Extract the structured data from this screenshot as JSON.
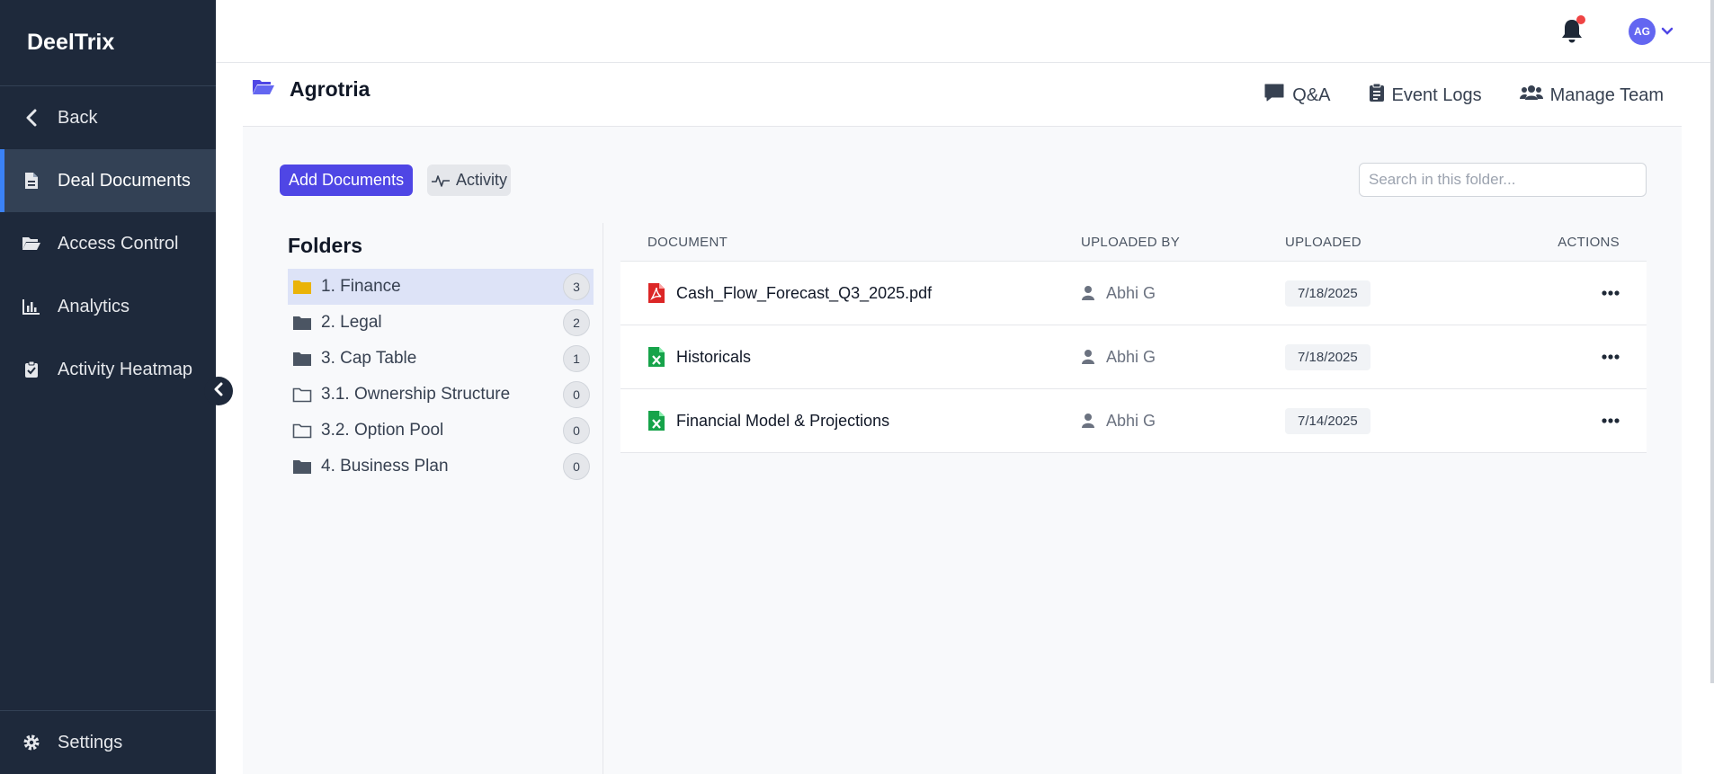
{
  "sidebar": {
    "brand": "DeelTrix",
    "items": [
      {
        "label": "Back",
        "icon": "chevron-left-icon"
      },
      {
        "label": "Deal Documents",
        "icon": "file-icon",
        "active": true
      },
      {
        "label": "Access Control",
        "icon": "folder-open-icon"
      },
      {
        "label": "Analytics",
        "icon": "chart-icon"
      },
      {
        "label": "Activity Heatmap",
        "icon": "clipboard-check-icon"
      }
    ],
    "settings_label": "Settings"
  },
  "topbar": {
    "avatar_initials": "AG"
  },
  "project": {
    "title": "Agrotria",
    "actions": {
      "qa": "Q&A",
      "event_logs": "Event Logs",
      "manage_team": "Manage Team"
    }
  },
  "toolbar": {
    "add_documents": "Add Documents",
    "activity": "Activity",
    "search_placeholder": "Search in this folder..."
  },
  "folders": {
    "title": "Folders",
    "items": [
      {
        "label": "1. Finance",
        "count": "3",
        "active": true
      },
      {
        "label": "2. Legal",
        "count": "2"
      },
      {
        "label": "3. Cap Table",
        "count": "1"
      },
      {
        "label": "3.1. Ownership Structure",
        "count": "0"
      },
      {
        "label": "3.2. Option Pool",
        "count": "0"
      },
      {
        "label": "4. Business Plan",
        "count": "0"
      }
    ]
  },
  "documents": {
    "columns": {
      "document": "DOCUMENT",
      "uploaded_by": "UPLOADED BY",
      "uploaded": "UPLOADED",
      "actions": "ACTIONS"
    },
    "rows": [
      {
        "name": "Cash_Flow_Forecast_Q3_2025.pdf",
        "type": "pdf",
        "uploaded_by": "Abhi G",
        "uploaded": "7/18/2025"
      },
      {
        "name": "Historicals",
        "type": "excel",
        "uploaded_by": "Abhi G",
        "uploaded": "7/18/2025"
      },
      {
        "name": "Financial Model & Projections",
        "type": "excel",
        "uploaded_by": "Abhi G",
        "uploaded": "7/14/2025"
      }
    ]
  },
  "colors": {
    "sidebar_bg": "#1e293b",
    "accent": "#4f46e5",
    "active_indicator": "#3b82f6",
    "pdf_red": "#dc2626",
    "excel_green": "#16a34a",
    "folder_active": "#eab308",
    "notification_dot": "#ef4444"
  }
}
